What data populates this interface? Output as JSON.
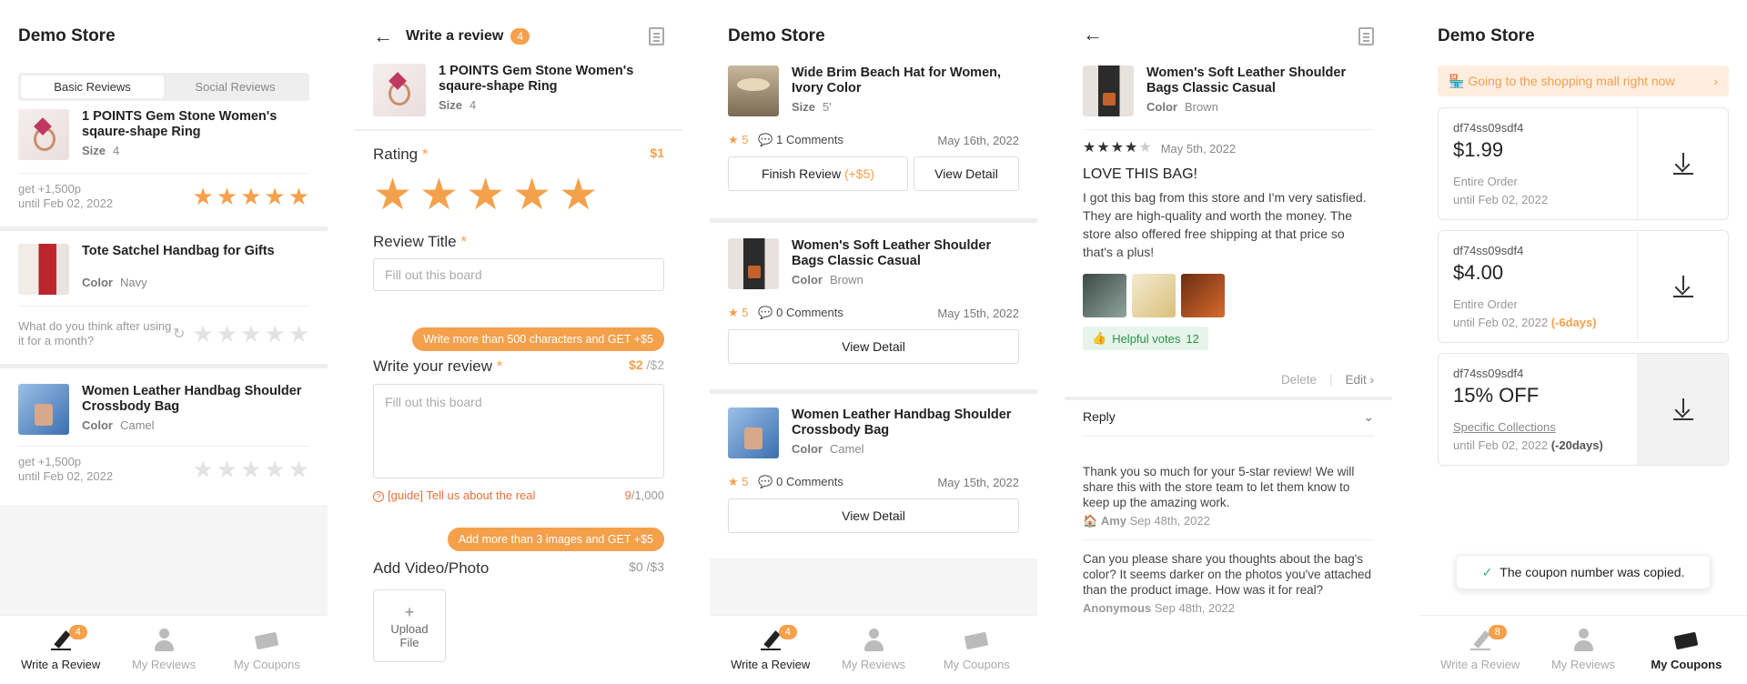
{
  "colors": {
    "accent": "#f5a04b",
    "helpful_bg": "#e6f4ea",
    "helpful_text": "#2f8f4a"
  },
  "screen1": {
    "title": "Demo Store",
    "tabs": [
      "Basic Reviews",
      "Social Reviews"
    ],
    "items": [
      {
        "name": "1 POINTS Gem Stone Women's sqaure-shape Ring",
        "opt_label": "Size",
        "opt_value": "4",
        "points": "get +1,500p",
        "until": "until Feb 02, 2022",
        "rating": 5
      },
      {
        "name": "Tote Satchel Handbag for Gifts",
        "opt_label": "Color",
        "opt_value": "Navy",
        "question": "What do you think after using it for a month?",
        "rating": 0
      },
      {
        "name": "Women Leather Handbag Shoulder Crossbody Bag",
        "opt_label": "Color",
        "opt_value": "Camel",
        "points": "get +1,500p",
        "until": "until Feb 02, 2022",
        "rating": 0
      }
    ]
  },
  "screen2": {
    "title": "Write a review",
    "badge": "4",
    "product": {
      "name": "1 POINTS Gem Stone Women's sqaure-shape Ring",
      "opt_label": "Size",
      "opt_value": "4"
    },
    "rating_label": "Rating",
    "rating_amount": "$1",
    "rating_value": 5,
    "title_label": "Review Title",
    "title_placeholder": "Fill out this board",
    "promo1": "Write more than 500 characters and GET +$5",
    "review_label": "Write your review",
    "review_amount": "$2",
    "review_amount_max": " /$2",
    "review_placeholder": "Fill out this board",
    "guide": "[guide] Tell us about the real",
    "count": "9",
    "count_max": "/1,000",
    "promo2": "Add more than 3 images and GET +$5",
    "media_label": "Add Video/Photo",
    "media_amount": "$0 /$3",
    "upload_label": "Upload File"
  },
  "screen3": {
    "title": "Demo Store",
    "items": [
      {
        "name": "Wide Brim Beach Hat for Women, Ivory Color",
        "opt_label": "Size",
        "opt_value": "5'",
        "rating": "5",
        "comments": "1 Comments",
        "date": "May 16th, 2022",
        "btn1": "Finish Review",
        "btn1_extra": "(+$5)",
        "btn2": "View Detail"
      },
      {
        "name": "Women's Soft Leather Shoulder Bags Classic Casual",
        "opt_label": "Color",
        "opt_value": "Brown",
        "rating": "5",
        "comments": "0 Comments",
        "date": "May 15th, 2022",
        "btn": "View Detail"
      },
      {
        "name": "Women Leather Handbag Shoulder Crossbody Bag",
        "opt_label": "Color",
        "opt_value": "Camel",
        "rating": "5",
        "comments": "0 Comments",
        "date": "May 15th, 2022",
        "btn": "View Detail"
      }
    ]
  },
  "screen4": {
    "product": {
      "name": "Women's Soft Leather Shoulder Bags Classic Casual",
      "opt_label": "Color",
      "opt_value": "Brown"
    },
    "rating": 4,
    "date": "May 5th, 2022",
    "headline": "LOVE THIS BAG!",
    "body": "I got this bag from this store and I'm very satisfied. They are high-quality and worth the money. The store also offered free shipping at that price so that's a plus!",
    "helpful_label": "Helpful votes",
    "helpful_count": "12",
    "delete": "Delete",
    "edit": "Edit",
    "reply_label": "Reply",
    "replies": [
      {
        "text": "Thank you so much for your 5-star review! We will share this with the store team to let them know to keep up the amazing work.",
        "author": "Amy",
        "date": "Sep 48th, 2022"
      },
      {
        "text": "Can you please share you thoughts about the bag's color? It seems darker on the photos you've attached than the product image. How was it for real?",
        "author": "Anonymous",
        "date": "Sep 48th, 2022"
      }
    ]
  },
  "screen5": {
    "title": "Demo Store",
    "banner": "Going to the shopping mall right now",
    "coupons": [
      {
        "code": "df74ss09sdf4",
        "value": "$1.99",
        "scope": "Entire Order",
        "until": "until Feb 02, 2022",
        "extra": ""
      },
      {
        "code": "df74ss09sdf4",
        "value": "$4.00",
        "scope": "Entire Order",
        "until": "until Feb 02, 2022",
        "extra": "(-6days)"
      },
      {
        "code": "df74ss09sdf4",
        "value": "15% OFF",
        "scope": "Specific Collections",
        "until": "until Feb 02, 2022",
        "extra": "(-20days)"
      }
    ],
    "toast": "The coupon number was copied."
  },
  "tabbar": {
    "write": "Write a Review",
    "reviews": "My Reviews",
    "coupons": "My Coupons",
    "badge_a": "4",
    "badge_b": "8"
  }
}
